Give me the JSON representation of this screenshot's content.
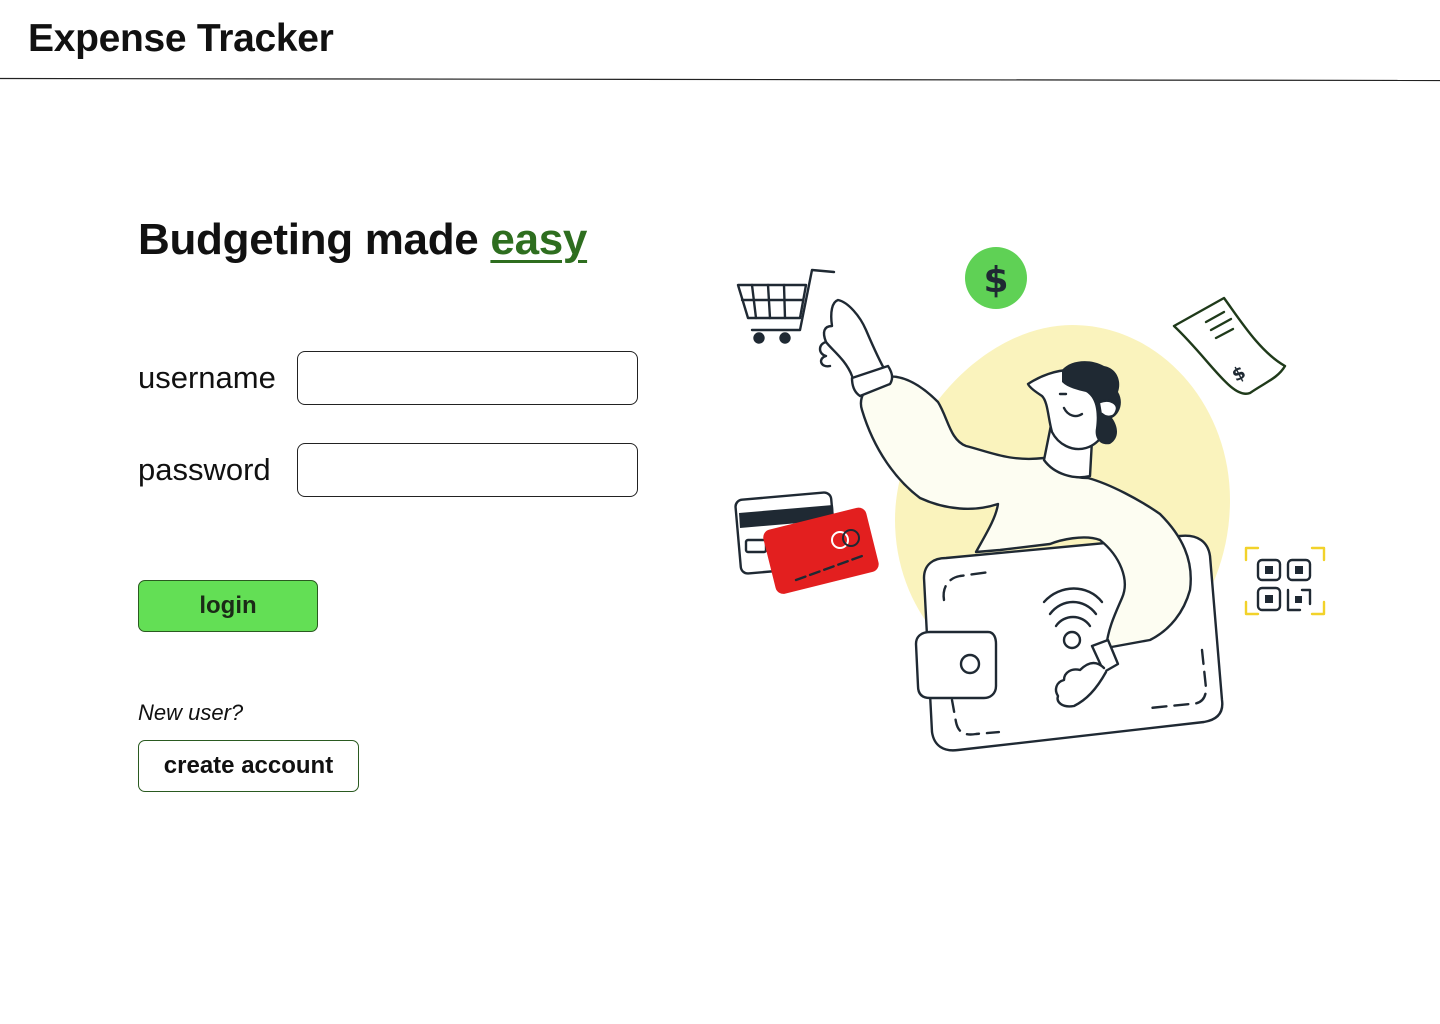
{
  "header": {
    "title": "Expense Tracker"
  },
  "hero": {
    "heading_prefix": "Budgeting made ",
    "heading_accent": "easy",
    "accent_color": "#2e6e1f"
  },
  "form": {
    "username_label": "username",
    "username_value": "",
    "password_label": "password",
    "password_value": "",
    "login_label": "login",
    "login_color": "#63df55"
  },
  "signup": {
    "prompt": "New user?",
    "create_label": "create account"
  },
  "illustration": {
    "icons": [
      "shopping-cart-icon",
      "dollar-coin-icon",
      "receipt-icon",
      "credit-cards-icon",
      "wallet-icon",
      "qr-code-icon",
      "contactless-icon"
    ],
    "colors": {
      "coin": "#5fd155",
      "blob": "#faf3bd",
      "card_red": "#e31f1f",
      "qr_corner": "#f2d22a",
      "outline": "#1f2933",
      "body": "#fdfdf2"
    }
  }
}
